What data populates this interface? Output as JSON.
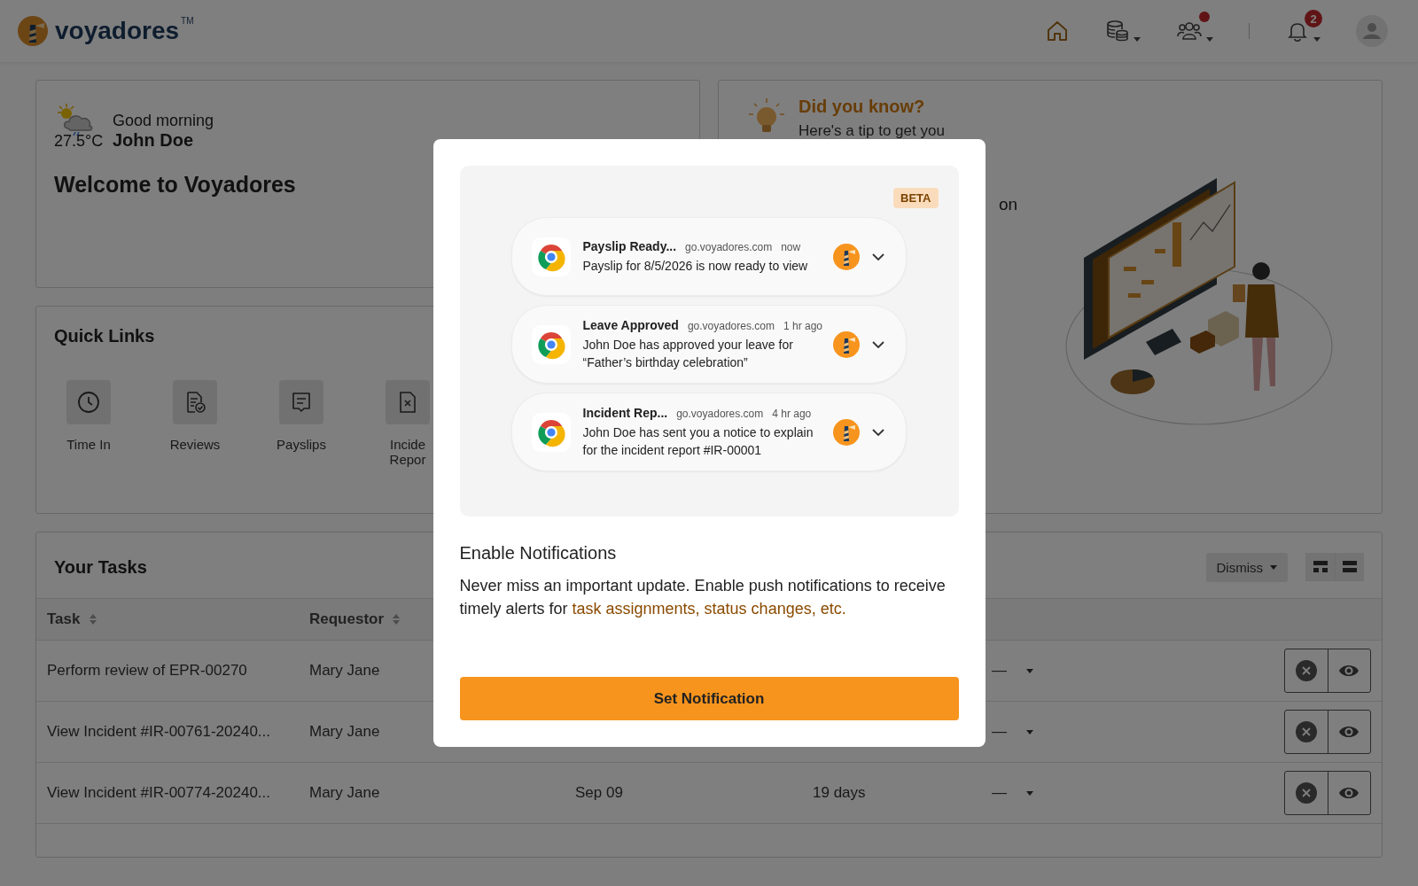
{
  "header": {
    "logo_text": "voyadores",
    "trademark": "TM",
    "team_alert": true,
    "notification_count": "2"
  },
  "welcome": {
    "temperature": "27.5°C",
    "greeting": "Good morning",
    "name": "John Doe",
    "title": "Welcome to Voyadores"
  },
  "tip": {
    "title": "Did you know?",
    "text": "Here's a tip to get you",
    "fragment": "on"
  },
  "quick_links": {
    "title": "Quick Links",
    "items": [
      {
        "kind": "clock",
        "lines": [
          "Time In"
        ]
      },
      {
        "kind": "review",
        "lines": [
          "Reviews"
        ]
      },
      {
        "kind": "payslip",
        "lines": [
          "Payslips"
        ]
      },
      {
        "kind": "incident",
        "lines": [
          "Incide",
          "Repor"
        ]
      }
    ]
  },
  "tasks": {
    "title": "Your Tasks",
    "dismiss_label": "Dismiss",
    "view_modes": [
      {
        "kind": "grid"
      },
      {
        "kind": "list"
      }
    ],
    "columns": [
      "Task",
      "Requestor"
    ],
    "rows": [
      {
        "task": "Perform review of EPR-00270",
        "requestor": "Mary Jane",
        "status": "—"
      },
      {
        "task": "View Incident #IR-00761-20240...",
        "requestor": "Mary Jane",
        "status": "—"
      },
      {
        "task": "View Incident #IR-00774-20240...",
        "requestor": "Mary Jane",
        "date": "Sep 09",
        "age": "19 days",
        "status": "—"
      }
    ]
  },
  "modal": {
    "badge": "BETA",
    "notifications": [
      {
        "title": "Payslip Ready...",
        "source": "go.voyadores.com",
        "time": "now",
        "body": "Payslip for 8/5/2026 is now ready to view"
      },
      {
        "title": "Leave Approved",
        "source": "go.voyadores.com",
        "time": "1 hr ago",
        "body": "John Doe has approved your leave for “Father’s birthday celebration”"
      },
      {
        "title": "Incident Rep...",
        "source": "go.voyadores.com",
        "time": "4 hr ago",
        "body": "John Doe has sent you a notice to explain for the incident report #IR-00001"
      }
    ],
    "heading": "Enable Notifications",
    "text": "Never miss an important update. Enable push notifications to receive timely alerts for",
    "link": "task assignments, status changes, etc.",
    "button": "Set Notification"
  }
}
